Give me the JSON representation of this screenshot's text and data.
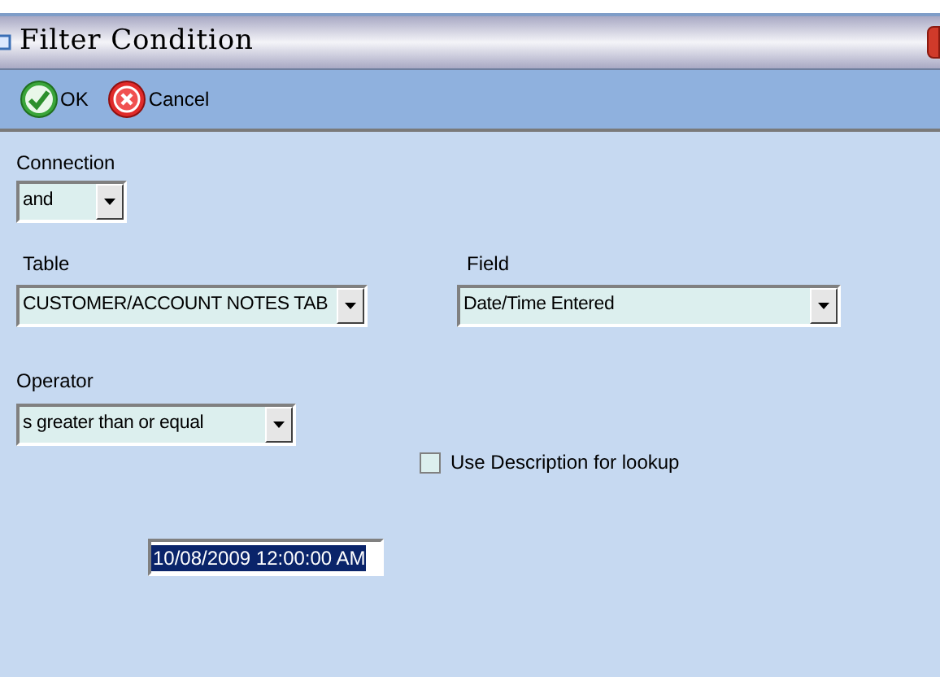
{
  "window": {
    "title": "Filter Condition"
  },
  "toolbar": [
    {
      "kind": "ok",
      "label": "OK"
    },
    {
      "kind": "cancel",
      "label": "Cancel"
    }
  ],
  "connection": {
    "label": "Connection",
    "value": "and"
  },
  "table": {
    "label": "Table",
    "value": "CUSTOMER/ACCOUNT NOTES TAB"
  },
  "field": {
    "label": "Field",
    "value": "Date/Time Entered"
  },
  "operator": {
    "label": "Operator",
    "value": "s greater than or equal"
  },
  "use_description": {
    "label": "Use Description for lookup",
    "checked": false
  },
  "value_field": {
    "value": "10/08/2009 12:00:00 AM",
    "text_selected": true
  }
}
